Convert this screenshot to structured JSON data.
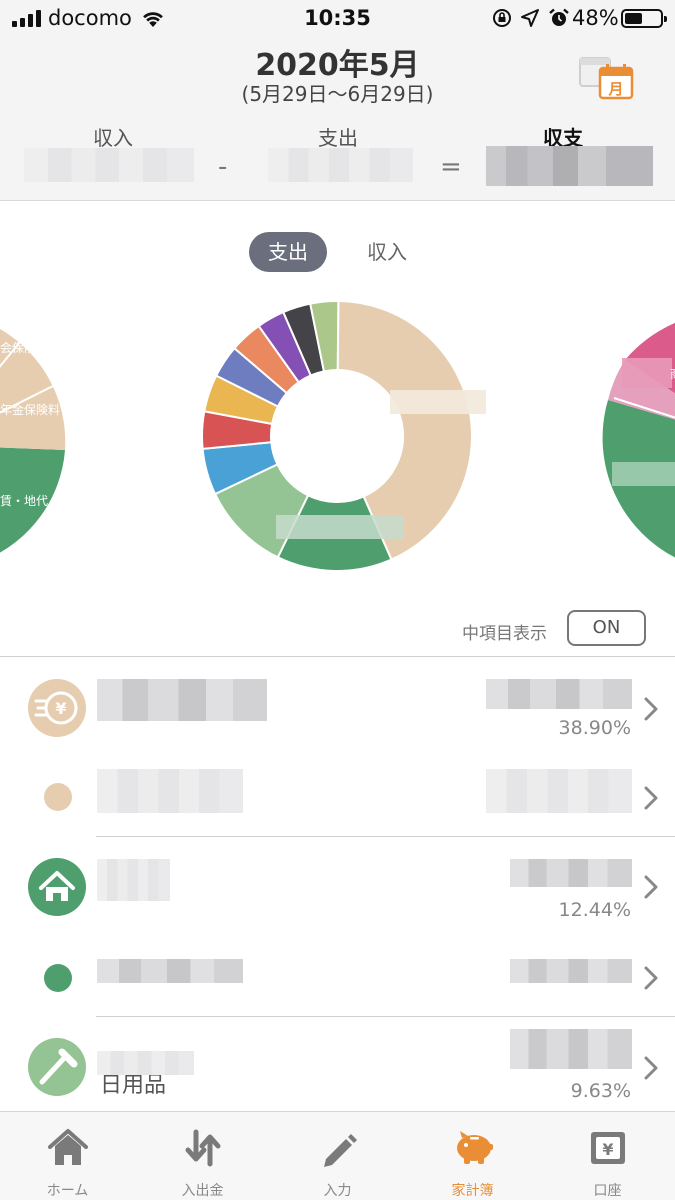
{
  "status_bar": {
    "carrier": "docomo",
    "time": "10:35",
    "battery_percent": "48%"
  },
  "header": {
    "title": "2020年5月",
    "range": "(5月29日〜6月29日)",
    "income_label": "収入",
    "expense_label": "支出",
    "balance_label": "収支",
    "minus_sign": "-",
    "equals_sign": "=",
    "calendar_icon_text": "月"
  },
  "segment": {
    "expense_label": "支出",
    "income_label": "収入",
    "selected": "支出"
  },
  "chart": {
    "left_pie_labels": [
      "会保険",
      "年金保険料",
      "賃・地代"
    ],
    "right_pie_label": "商"
  },
  "chart_data": {
    "type": "pie",
    "slices": [
      {
        "color": "#e6cdb0",
        "percent": 38.9
      },
      {
        "color": "#4f9f6e",
        "percent": 12.44
      },
      {
        "color": "#94c493",
        "percent": 9.63
      },
      {
        "color": "#4aa1d6",
        "percent": 5
      },
      {
        "color": "#d85454",
        "percent": 4
      },
      {
        "color": "#e9b651",
        "percent": 4
      },
      {
        "color": "#6d7dc0",
        "percent": 3.5
      },
      {
        "color": "#ea8960",
        "percent": 3.5
      },
      {
        "color": "#8550b5",
        "percent": 3
      },
      {
        "color": "#444448",
        "percent": 3
      },
      {
        "color": "#abc78a",
        "percent": 3
      }
    ]
  },
  "subcategory_toggle": {
    "label": "中項目表示",
    "value": "ON"
  },
  "list": {
    "rows": [
      {
        "percent": "38.90%",
        "icon": "money-icon",
        "color": "#e6cdb0"
      },
      {
        "percent": "",
        "icon": "dot-icon",
        "color": "#e6cdb0"
      },
      {
        "percent": "12.44%",
        "icon": "home-icon",
        "color": "#4f9f6e"
      },
      {
        "percent": "",
        "icon": "dot-icon",
        "color": "#4f9f6e"
      },
      {
        "percent": "9.63%",
        "icon": "toothbrush-icon",
        "color": "#94c493",
        "partial_label": "日用品"
      }
    ]
  },
  "tabs": [
    {
      "label": "ホーム",
      "icon": "home-icon"
    },
    {
      "label": "入出金",
      "icon": "transfer-icon"
    },
    {
      "label": "入力",
      "icon": "pencil-icon"
    },
    {
      "label": "家計簿",
      "icon": "piggybank-icon",
      "active": true
    },
    {
      "label": "口座",
      "icon": "wallet-icon"
    }
  ],
  "colors": {
    "accent": "#ea8e35",
    "segment_active": "#6b6f7d"
  }
}
